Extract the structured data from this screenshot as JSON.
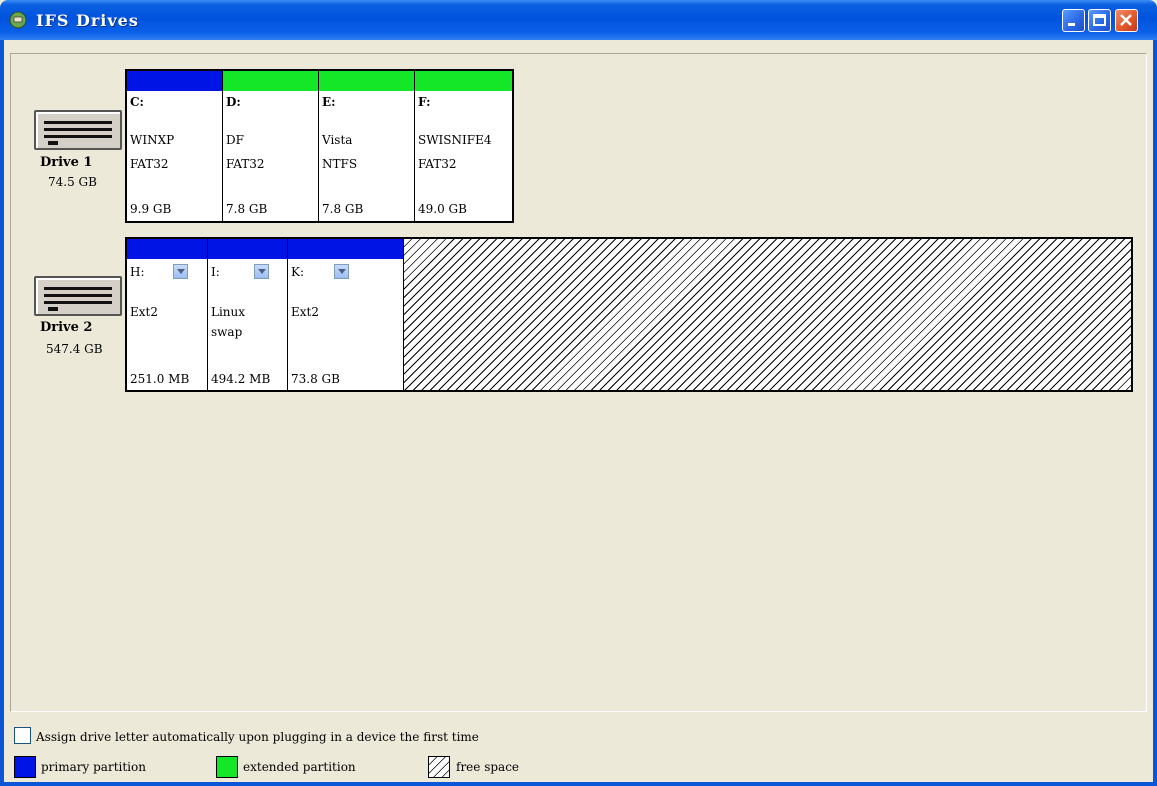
{
  "window": {
    "title": "IFS Drives"
  },
  "drives": [
    {
      "name": "Drive 1",
      "size": "74.5 GB",
      "partitions": [
        {
          "letter": "C:",
          "label": "WINXP",
          "fs": "FAT32",
          "size": "9.9 GB",
          "type": "primary"
        },
        {
          "letter": "D:",
          "label": "DF",
          "fs": "FAT32",
          "size": "7.8 GB",
          "type": "extended"
        },
        {
          "letter": "E:",
          "label": "Vista",
          "fs": "NTFS",
          "size": "7.8 GB",
          "type": "extended"
        },
        {
          "letter": "F:",
          "label": "SWISNIFE4",
          "fs": "FAT32",
          "size": "49.0 GB",
          "type": "extended"
        }
      ]
    },
    {
      "name": "Drive 2",
      "size": "547.4 GB",
      "partitions": [
        {
          "letter": "H:",
          "label": "Ext2",
          "fs": "",
          "size": "251.0 MB",
          "type": "primary"
        },
        {
          "letter": "I:",
          "label": "Linux",
          "fs": "swap",
          "size": "494.2 MB",
          "type": "primary"
        },
        {
          "letter": "K:",
          "label": "Ext2",
          "fs": "",
          "size": "73.8 GB",
          "type": "primary"
        }
      ]
    }
  ],
  "options": {
    "auto_assign_label": "Assign drive letter automatically upon plugging in a device the first time",
    "auto_assign_checked": false
  },
  "legend": {
    "primary": "primary partition",
    "extended": "extended partition",
    "free": "free space"
  },
  "colors": {
    "primary": "#0014e6",
    "extended": "#14e628",
    "titlebar": "#0053dd"
  }
}
